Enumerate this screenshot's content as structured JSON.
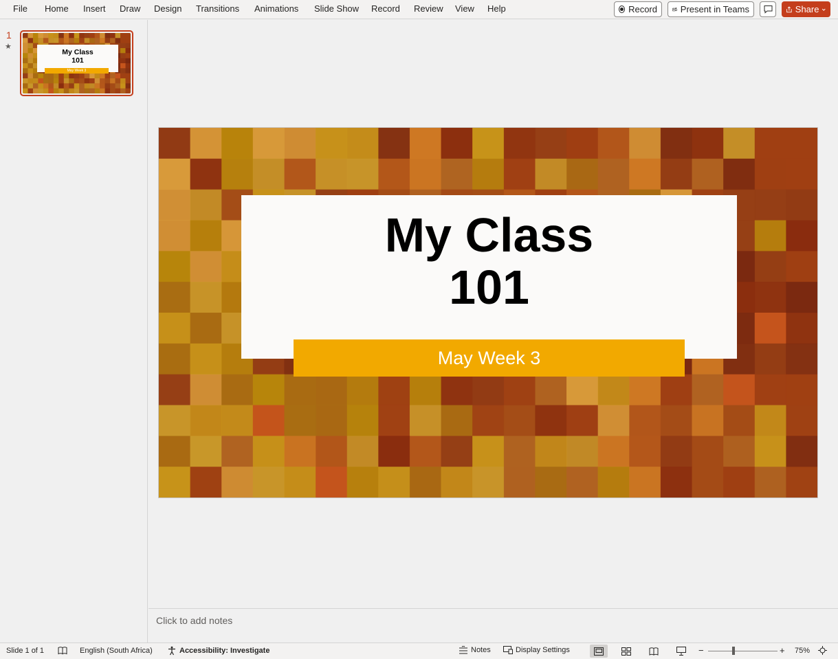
{
  "menu": {
    "items": [
      "File",
      "Home",
      "Insert",
      "Draw",
      "Design",
      "Transitions",
      "Animations",
      "Slide Show",
      "Record",
      "Review",
      "View",
      "Help"
    ],
    "record_button": "Record",
    "present_button": "Present in Teams",
    "share_button": "Share"
  },
  "thumbnails": [
    {
      "number": "1",
      "title_line1": "My Class",
      "title_line2": "101",
      "subtitle": "May Week 3"
    }
  ],
  "slide": {
    "title_line1": "My Class",
    "title_line2": "101",
    "subtitle": "May Week 3"
  },
  "notes": {
    "placeholder": "Click to add notes"
  },
  "statusbar": {
    "slide_count": "Slide 1 of 1",
    "language": "English (South Africa)",
    "accessibility": "Accessibility: Investigate",
    "notes": "Notes",
    "display_settings": "Display Settings",
    "zoom": "75%"
  },
  "colors": {
    "accent": "#c43e1c",
    "subtitle_bar": "#f2a900",
    "title_box": "#fbfaf9"
  }
}
